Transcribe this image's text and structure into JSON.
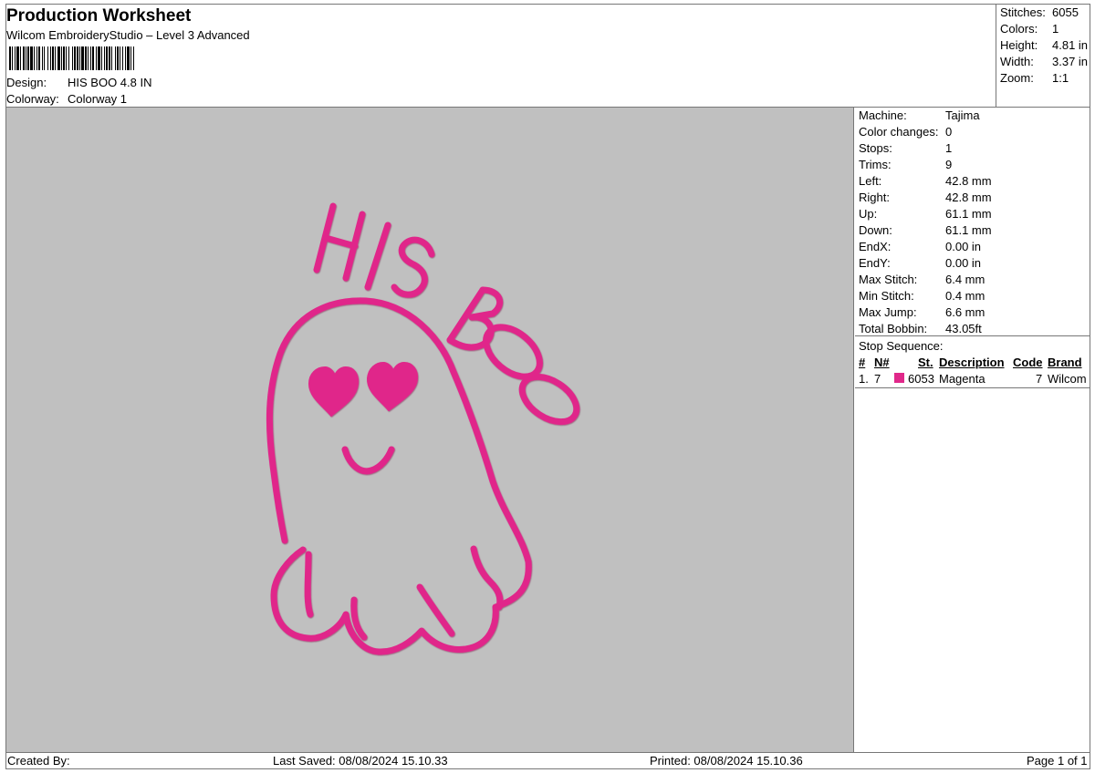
{
  "header": {
    "title": "Production Worksheet",
    "software": "Wilcom EmbroideryStudio – Level 3 Advanced",
    "design_label": "Design:",
    "design_value": "HIS BOO 4.8 IN",
    "colorway_label": "Colorway:",
    "colorway_value": "Colorway 1"
  },
  "stats": [
    {
      "label": "Stitches:",
      "value": "6055"
    },
    {
      "label": "Colors:",
      "value": "1"
    },
    {
      "label": "Height:",
      "value": "4.81 in"
    },
    {
      "label": "Width:",
      "value": "3.37 in"
    },
    {
      "label": "Zoom:",
      "value": "1:1"
    }
  ],
  "design": {
    "text": "HIS BOO",
    "thread_color": "#e0288a",
    "background_color": "#c0c0c0"
  },
  "machine_info": [
    {
      "label": "Machine:",
      "value": "Tajima"
    },
    {
      "label": "Color changes:",
      "value": "0"
    },
    {
      "label": "Stops:",
      "value": "1"
    },
    {
      "label": "Trims:",
      "value": "9"
    },
    {
      "label": "Left:",
      "value": "42.8 mm"
    },
    {
      "label": "Right:",
      "value": "42.8 mm"
    },
    {
      "label": "Up:",
      "value": "61.1 mm"
    },
    {
      "label": "Down:",
      "value": "61.1 mm"
    },
    {
      "label": "EndX:",
      "value": "0.00 in"
    },
    {
      "label": "EndY:",
      "value": "0.00 in"
    },
    {
      "label": "Max Stitch:",
      "value": "6.4 mm"
    },
    {
      "label": "Min Stitch:",
      "value": "0.4 mm"
    },
    {
      "label": "Max Jump:",
      "value": "6.6 mm"
    },
    {
      "label": "Total Bobbin:",
      "value": "43.05ft"
    }
  ],
  "stop_sequence": {
    "title": "Stop Sequence:",
    "columns": [
      "#",
      "N#",
      "St.",
      "Description",
      "Code",
      "Brand"
    ],
    "rows": [
      {
        "index": "1.",
        "needle": "7",
        "swatch_color": "#e0288a",
        "stitches": "6053",
        "description": "Magenta",
        "code": "7",
        "brand": "Wilcom"
      }
    ]
  },
  "footer": {
    "created_by": "Created By:",
    "last_saved": "Last Saved: 08/08/2024 15.10.33",
    "printed": "Printed: 08/08/2024 15.10.36",
    "page": "Page 1 of 1"
  }
}
